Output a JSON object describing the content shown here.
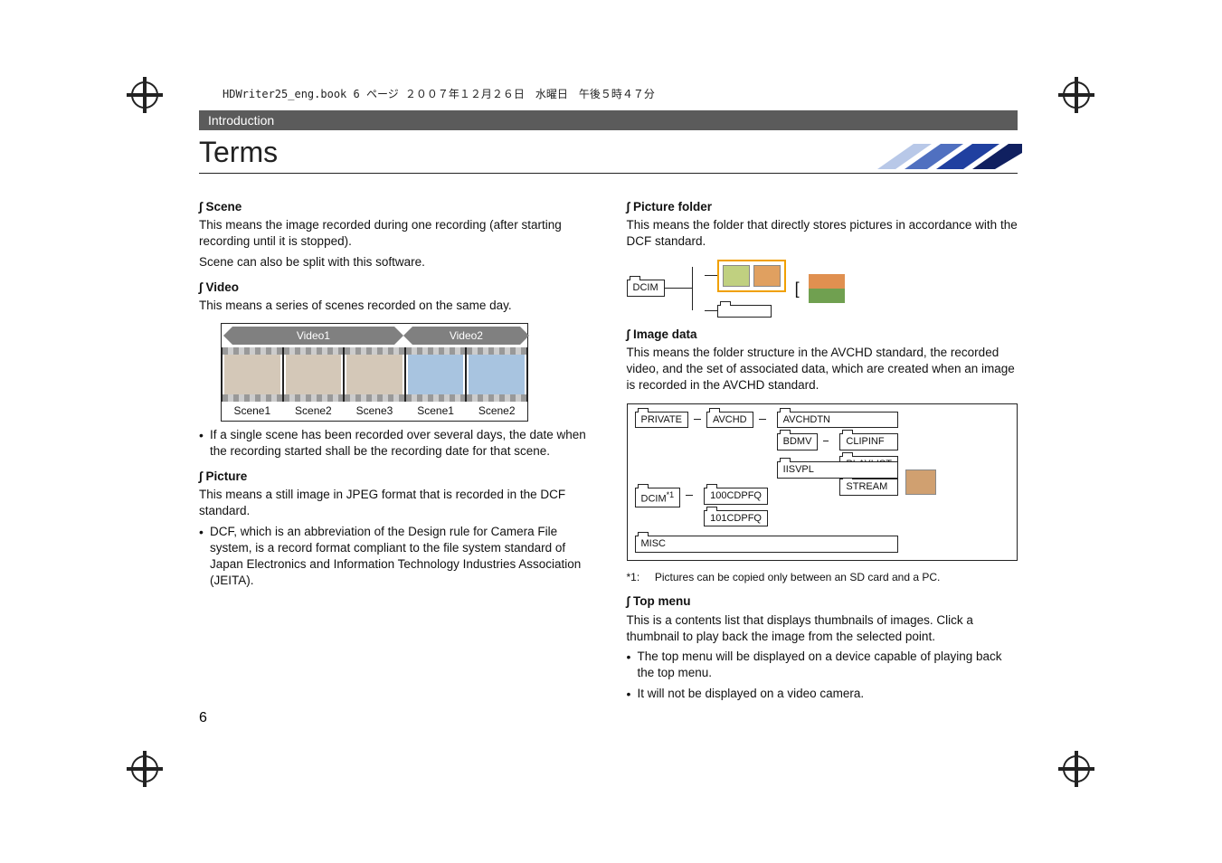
{
  "header_meta": "HDWriter25_eng.book  6 ページ  ２００７年１２月２６日　水曜日　午後５時４７分",
  "section_label": "Introduction",
  "page_title": "Terms",
  "page_number": "6",
  "left": {
    "scene": {
      "head": "Scene",
      "body1": "This means the image recorded during one recording (after starting recording until it is stopped).",
      "body2": "Scene can also be split with this software."
    },
    "video": {
      "head": "Video",
      "body": "This means a series of scenes recorded on the same day.",
      "label1": "Video1",
      "label2": "Video2",
      "s1": "Scene1",
      "s2": "Scene2",
      "s3": "Scene3",
      "s4": "Scene1",
      "s5": "Scene2",
      "note": "If a single scene has been recorded over several days, the date when the recording started shall be the recording date for that scene."
    },
    "picture": {
      "head": "Picture",
      "body": "This means a still image in JPEG format that is recorded in the DCF standard.",
      "note": "DCF, which is an abbreviation of the Design rule for Camera File system, is a record format compliant to the file system standard of Japan Electronics and Information Technology Industries Association (JEITA)."
    }
  },
  "right": {
    "pfolder": {
      "head": "Picture folder",
      "body": "This means the folder that directly stores pictures in accordance with the DCF standard.",
      "dcim": "DCIM"
    },
    "imagedata": {
      "head": "Image data",
      "body": "This means the folder structure in the AVCHD standard, the recorded video, and the set of associated data, which are created when an image is recorded in the AVCHD standard.",
      "nodes": {
        "private": "PRIVATE",
        "dcim": "DCIM",
        "dcim_sup": "*1",
        "misc": "MISC",
        "avchd": "AVCHD",
        "cdpfq1": "100CDPFQ",
        "cdpfq2": "101CDPFQ",
        "avchdtn": "AVCHDTN",
        "bdmv": "BDMV",
        "iisvpl": "IISVPL",
        "clipinf": "CLIPINF",
        "playlist": "PLAYLIST",
        "stream": "STREAM"
      },
      "footnote_label": "*1:",
      "footnote": "Pictures can be copied only between an SD card and a PC."
    },
    "topmenu": {
      "head": "Top menu",
      "body": "This is a contents list that displays thumbnails of images. Click a thumbnail to play back the image from the selected point.",
      "b1": "The top menu will be displayed on a device capable of playing back the top menu.",
      "b2": "It will not be displayed on a video camera."
    }
  }
}
